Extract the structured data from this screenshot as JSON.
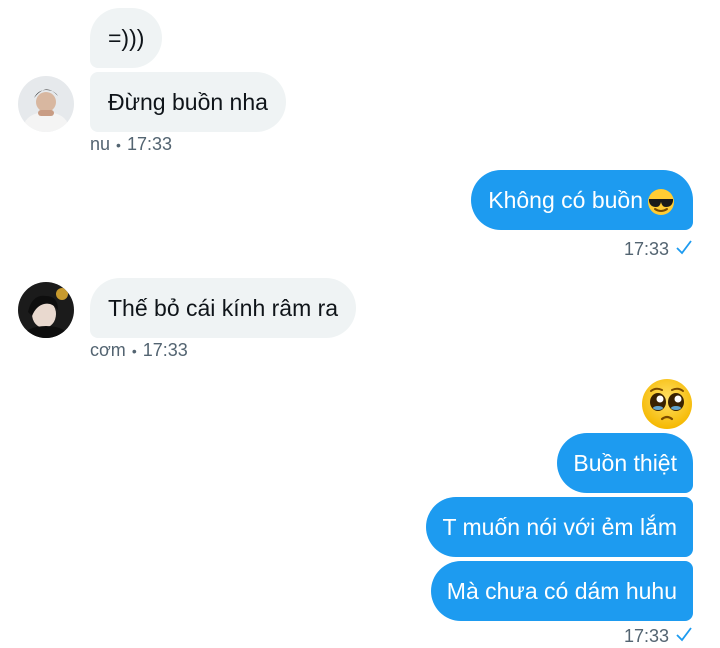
{
  "messages": {
    "m1": {
      "text": "=)))"
    },
    "m2": {
      "text": "Đừng buồn nha"
    },
    "m2_meta": {
      "sender": "nu",
      "time": "17:33"
    },
    "m3": {
      "text": "Không có buồn"
    },
    "m3_meta": {
      "time": "17:33"
    },
    "m4": {
      "text": "Thế bỏ cái kính râm ra"
    },
    "m4_meta": {
      "sender": "cơm",
      "time": "17:33"
    },
    "m5": {
      "text": "Buồn thiệt"
    },
    "m6": {
      "text": "T muốn nói với ẻm lắm"
    },
    "m7": {
      "text": "Mà chưa có dám huhu"
    },
    "m7_meta": {
      "time": "17:33"
    }
  },
  "icons": {
    "sunglasses": "smiling-face-with-sunglasses",
    "pleading": "pleading-face",
    "read_receipt": "check-icon"
  },
  "colors": {
    "outgoing_bubble": "#1d9bf0",
    "incoming_bubble": "#eff3f4",
    "meta_text": "#536471"
  }
}
